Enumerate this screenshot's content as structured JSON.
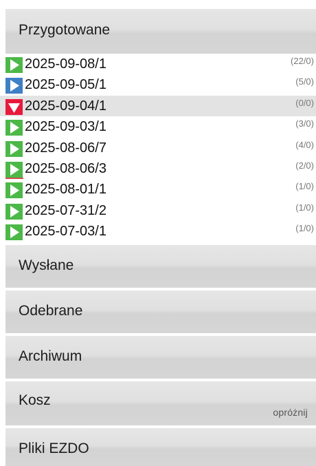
{
  "sections": {
    "prepared": {
      "title": "Przygotowane"
    },
    "sent": {
      "title": "Wysłane"
    },
    "received": {
      "title": "Odebrane"
    },
    "archive": {
      "title": "Archiwum"
    },
    "trash": {
      "title": "Kosz",
      "action": "opróżnij"
    },
    "files": {
      "title": "Pliki EZDO"
    }
  },
  "items": [
    {
      "name": "2025-09-08/1",
      "count": "(22/0)",
      "icon": "play-green-icon",
      "color": "#4cb848"
    },
    {
      "name": "2025-09-05/1",
      "count": "(5/0)",
      "icon": "play-blue-icon",
      "color": "#3f7fc6"
    },
    {
      "name": "2025-09-04/1",
      "count": "(0/0)",
      "icon": "expanded-red-icon",
      "color": "#e8193c"
    },
    {
      "name": "2025-09-03/1",
      "count": "(3/0)",
      "icon": "play-green-icon",
      "color": "#4cb848"
    },
    {
      "name": "2025-08-06/7",
      "count": "(4/0)",
      "icon": "play-green-icon",
      "color": "#4cb848"
    },
    {
      "name": "2025-08-06/3",
      "count": "(2/0)",
      "icon": "play-green-icon",
      "color": "#4cb848"
    },
    {
      "name": "2025-08-01/1",
      "count": "(1/0)",
      "icon": "play-green-icon",
      "color": "#4cb848"
    },
    {
      "name": "2025-07-31/2",
      "count": "(1/0)",
      "icon": "play-green-icon",
      "color": "#4cb848"
    },
    {
      "name": "2025-07-03/1",
      "count": "(1/0)",
      "icon": "play-green-icon",
      "color": "#4cb848"
    }
  ]
}
